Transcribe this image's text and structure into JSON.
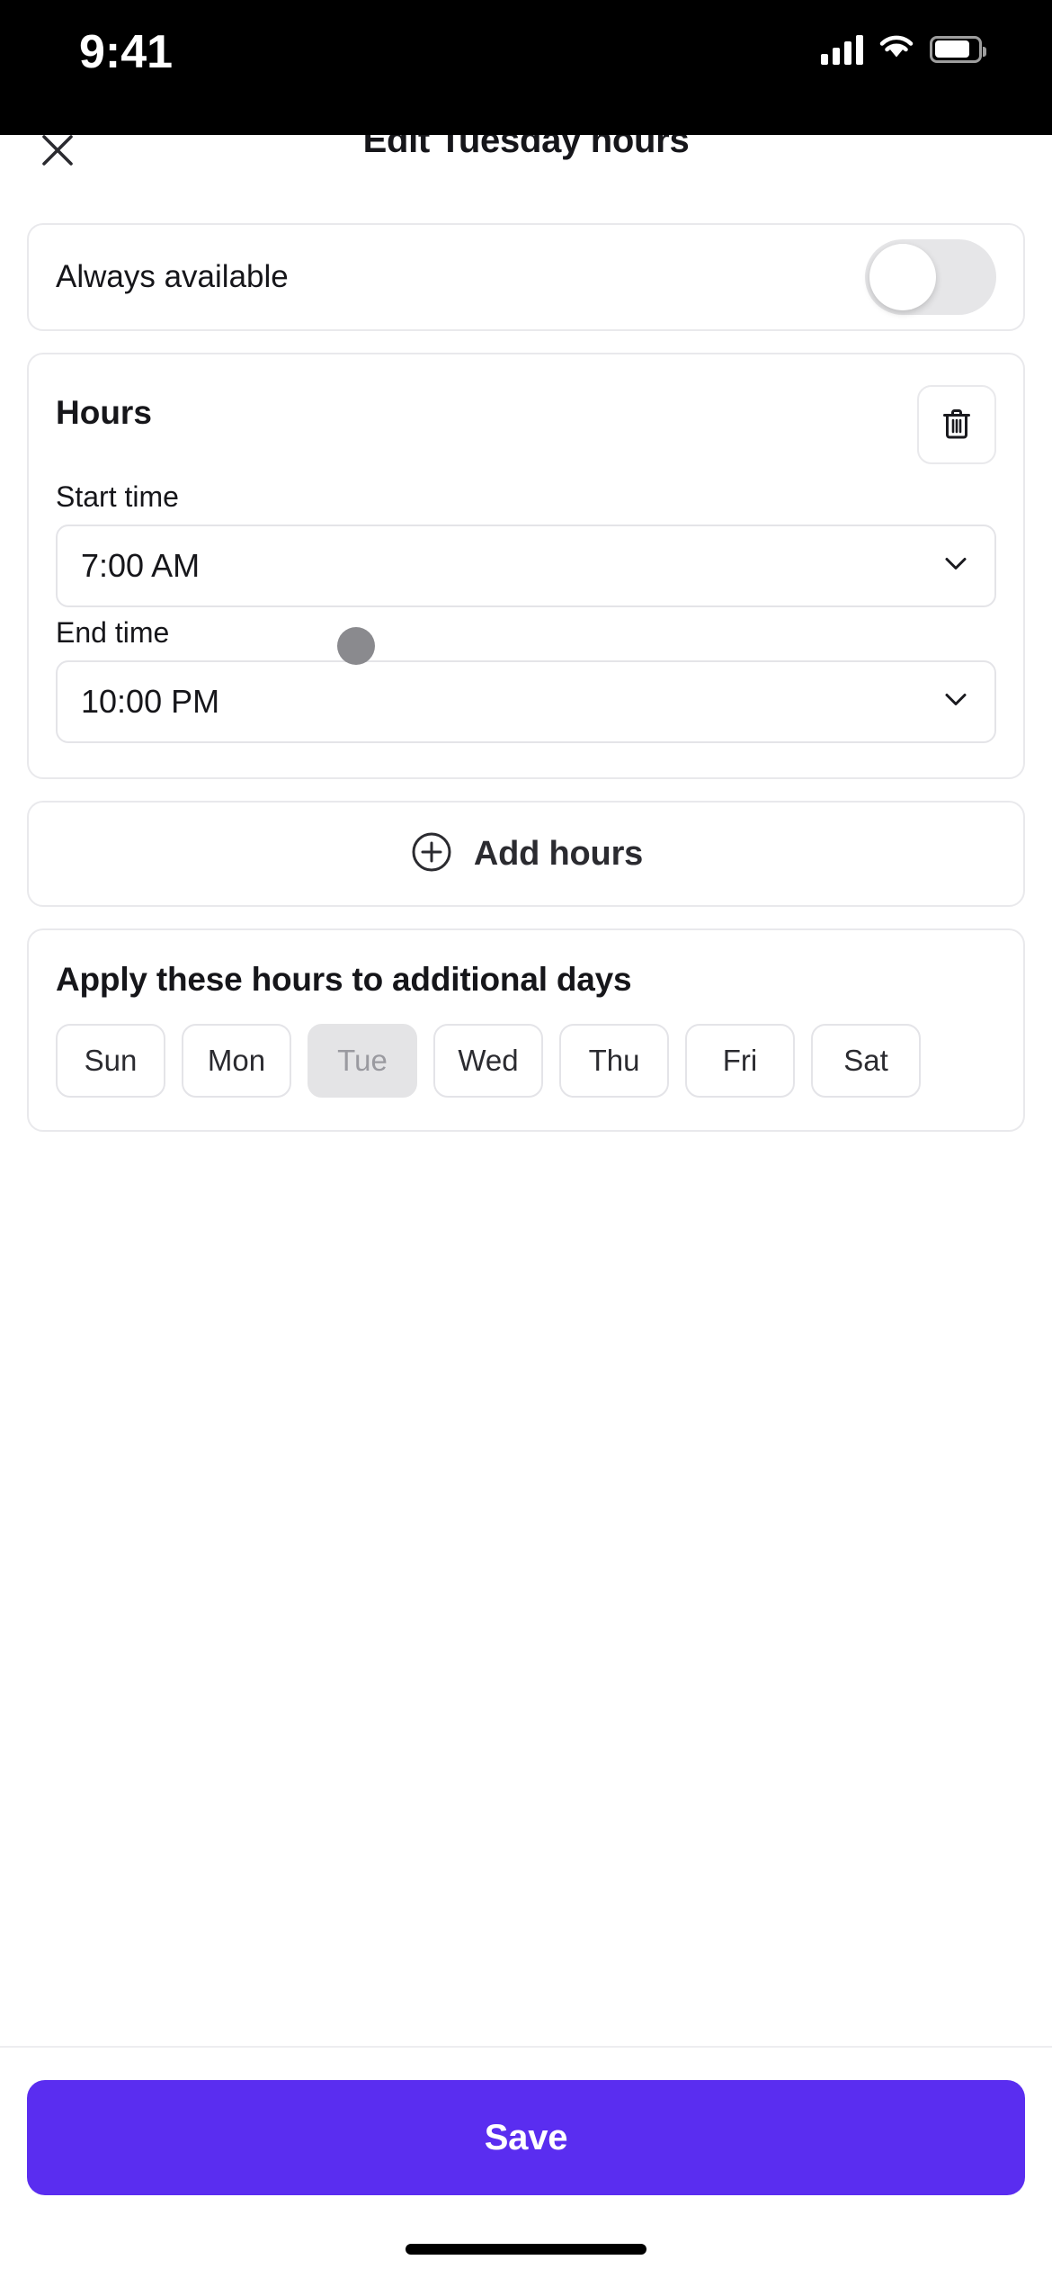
{
  "status_bar": {
    "time": "9:41",
    "signal_icon": "cellular-signal-icon",
    "wifi_icon": "wifi-icon",
    "battery_icon": "battery-icon"
  },
  "header": {
    "title": "Edit Tuesday hours",
    "close_icon": "close-icon"
  },
  "always_available": {
    "label": "Always available",
    "toggle_state": "off"
  },
  "hours": {
    "title": "Hours",
    "delete_icon": "trash-icon",
    "start_time": {
      "label": "Start time",
      "value": "7:00 AM",
      "chevron_icon": "chevron-down-icon"
    },
    "end_time": {
      "label": "End time",
      "value": "10:00 PM",
      "chevron_icon": "chevron-down-icon"
    }
  },
  "add_hours": {
    "label": "Add hours",
    "icon": "plus-circle-icon"
  },
  "apply_days": {
    "title": "Apply these hours to additional days",
    "chips": [
      {
        "label": "Sun",
        "disabled": false
      },
      {
        "label": "Mon",
        "disabled": false
      },
      {
        "label": "Tue",
        "disabled": true
      },
      {
        "label": "Wed",
        "disabled": false
      },
      {
        "label": "Thu",
        "disabled": false
      },
      {
        "label": "Fri",
        "disabled": false
      },
      {
        "label": "Sat",
        "disabled": false
      }
    ]
  },
  "footer": {
    "save_label": "Save"
  },
  "colors": {
    "accent": "#5A2DF0",
    "text_primary": "#16161A",
    "text_muted": "#9A9AA0",
    "border": "#E4E4E8",
    "chip_disabled_bg": "#E4E4E6",
    "toggle_track": "#E6E6E8"
  }
}
